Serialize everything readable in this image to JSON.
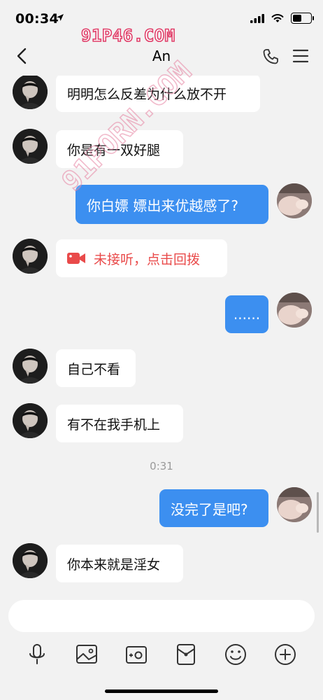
{
  "status_bar": {
    "time": "00:34"
  },
  "watermark": "91P46.COM",
  "watermark_diagonal": "91PORN.COM",
  "nav": {
    "title": "An"
  },
  "messages": [
    {
      "side": "left",
      "text": "明明怎么反差为什么放不开"
    },
    {
      "side": "left",
      "text": "你是有一双好腿"
    },
    {
      "side": "right",
      "text": "你白嫖 嫖出来优越感了?"
    },
    {
      "side": "left",
      "text": "未接听，点击回拨",
      "type": "missed-call"
    },
    {
      "side": "right",
      "text": "......"
    },
    {
      "side": "left",
      "text": "自己不看"
    },
    {
      "side": "left",
      "text": "有不在我手机上"
    },
    {
      "side": "right",
      "text": "没完了是吧?"
    },
    {
      "side": "left",
      "text": "你本来就是淫女"
    }
  ],
  "timestamp": "0:31",
  "colors": {
    "sent_bubble": "#3c8ff0",
    "missed_call": "#e94a4a"
  },
  "toolbar_icons": [
    "microphone-icon",
    "image-icon",
    "camera-icon",
    "red-packet-icon",
    "emoji-icon",
    "plus-icon"
  ]
}
